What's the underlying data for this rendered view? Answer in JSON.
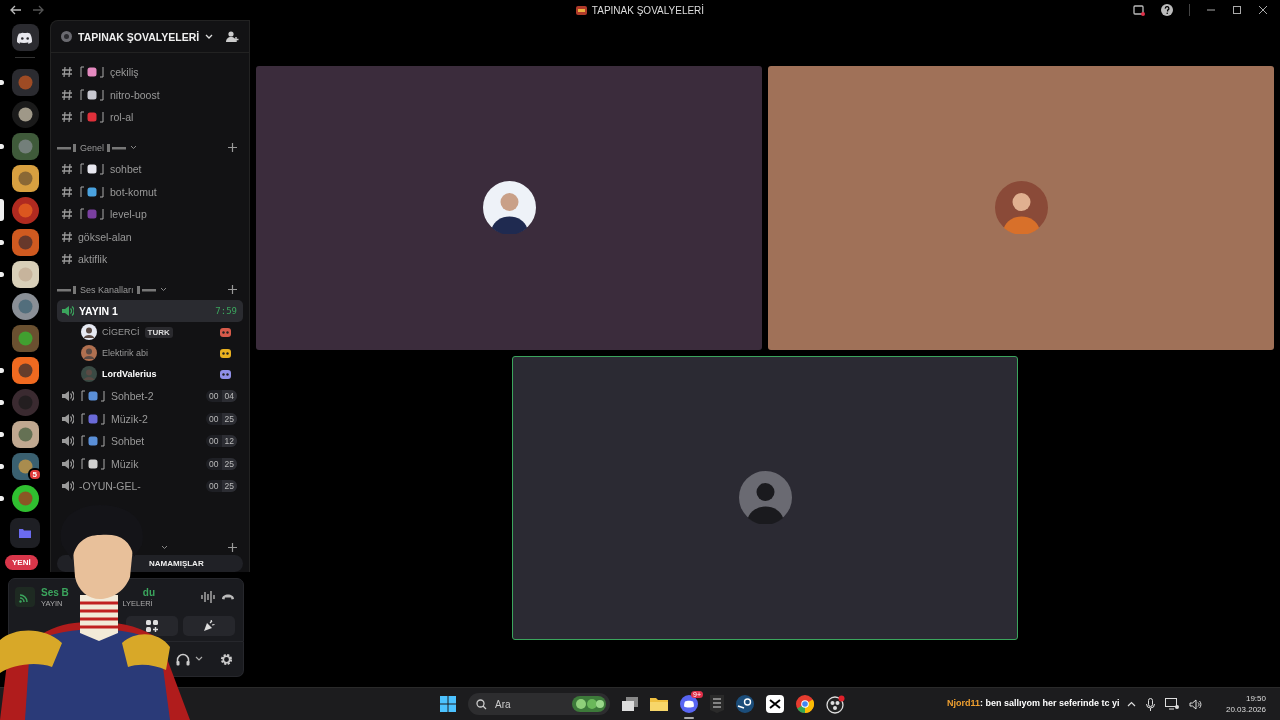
{
  "window": {
    "title": "TAPINAK ŞOVALYELERİ"
  },
  "servers": [
    {
      "unread": true,
      "selected": false
    },
    {
      "unread": false,
      "selected": false
    },
    {
      "unread": true,
      "selected": false
    },
    {
      "unread": false,
      "selected": false
    },
    {
      "unread": true,
      "selected": true
    },
    {
      "unread": true,
      "selected": false
    },
    {
      "unread": true,
      "selected": false
    },
    {
      "unread": false,
      "selected": false
    },
    {
      "unread": false,
      "selected": false
    },
    {
      "unread": true,
      "selected": false
    },
    {
      "unread": true,
      "selected": false
    },
    {
      "unread": true,
      "selected": false
    },
    {
      "unread": true,
      "selected": false,
      "badge": "5"
    },
    {
      "unread": true,
      "selected": false
    }
  ],
  "new_badge": "YENİ",
  "server_name": "TAPINAK ŞOVALYELERİ",
  "channels": [
    {
      "kind": "text",
      "name": "çekiliş",
      "color": "#e58ac0"
    },
    {
      "kind": "text",
      "name": "nitro-boost",
      "color": "#c8c8d0"
    },
    {
      "kind": "text",
      "name": "rol-al",
      "color": "#e0303a"
    },
    {
      "kind": "category",
      "name": "Genel"
    },
    {
      "kind": "text",
      "name": "sohbet",
      "color": "#e8e8f0"
    },
    {
      "kind": "text",
      "name": "bot-komut",
      "color": "#4aa3e0"
    },
    {
      "kind": "text",
      "name": "level-up",
      "color": "#7a3fa0"
    },
    {
      "kind": "text",
      "name": "göksel-alan"
    },
    {
      "kind": "text",
      "name": "aktiflik"
    },
    {
      "kind": "category",
      "name": "Ses Kanalları"
    },
    {
      "kind": "voice",
      "name": "YAYIN 1",
      "selected": true,
      "time": "7:59",
      "members": [
        {
          "name": "CİGERCİ",
          "tag": "TURK",
          "color": "#e6e9f2",
          "speaking": false
        },
        {
          "name": "Elektirik abi",
          "color": "#b07050",
          "speaking": false
        },
        {
          "name": "LordValerius",
          "color": "#3a4a44",
          "speaking": true
        }
      ]
    },
    {
      "kind": "voice",
      "name": "Sohbet-2",
      "color": "#5a8fd8",
      "selected": false,
      "counts": [
        "00",
        "04"
      ]
    },
    {
      "kind": "voice",
      "name": "Müzik-2",
      "color": "#6a6ad8",
      "selected": false,
      "counts": [
        "00",
        "25"
      ]
    },
    {
      "kind": "voice",
      "name": "Sohbet",
      "color": "#5a8fd8",
      "selected": false,
      "counts": [
        "00",
        "12"
      ]
    },
    {
      "kind": "voice",
      "name": "Müzik",
      "color": "#d0d0d0",
      "selected": false,
      "counts": [
        "00",
        "25"
      ]
    },
    {
      "kind": "voice",
      "name": "-OYUN-GEL-",
      "selected": false,
      "counts": [
        "00",
        "25"
      ]
    }
  ],
  "unread_button": "NAMAMIŞLAR",
  "voice_panel": {
    "status_parts": [
      "Ses B",
      "du"
    ],
    "channel_parts": [
      "YAYIN",
      "LYELERİ"
    ]
  },
  "tiles": [
    {
      "color": "#3b2c3c",
      "speaking": false
    },
    {
      "color": "#a07158",
      "speaking": false
    },
    {
      "color": "#2b2a33",
      "speaking": true
    }
  ],
  "taskbar": {
    "search_placeholder": "Ara",
    "discord_badge": "9+",
    "chat_user": "Njord11",
    "chat_text": ": ben sallıyom her seferinde tc yi",
    "time": "19:50",
    "date": "20.03.2026"
  }
}
